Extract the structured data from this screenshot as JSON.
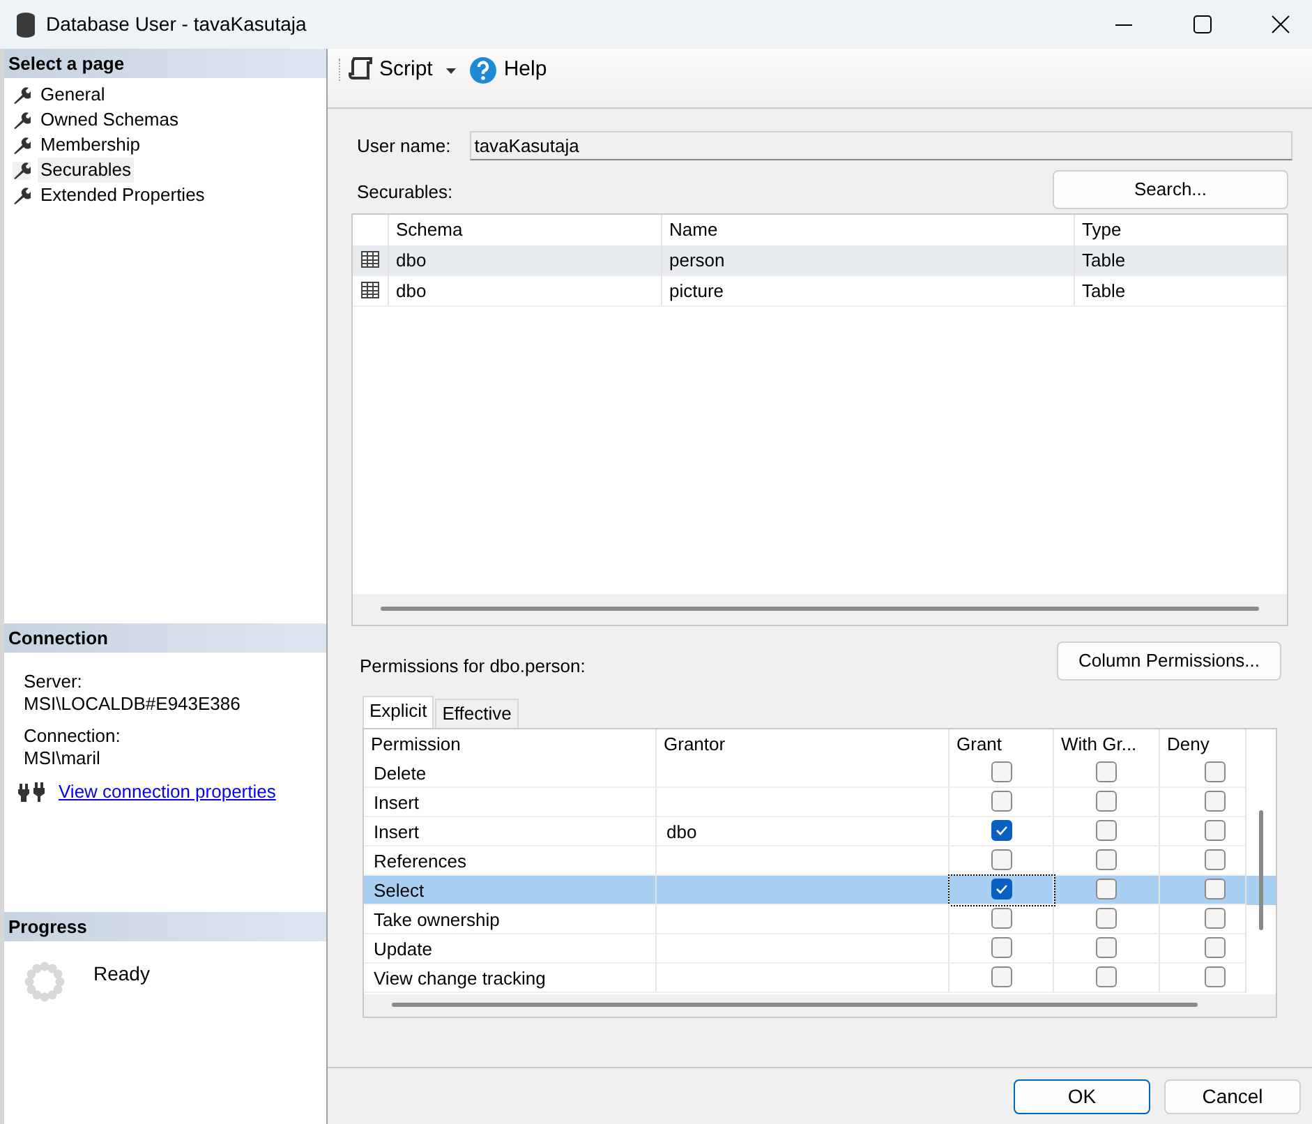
{
  "window": {
    "title": "Database User - tavaKasutaja"
  },
  "sidebar": {
    "title": "Select a page",
    "items": [
      {
        "label": "General",
        "selected": false
      },
      {
        "label": "Owned Schemas",
        "selected": false
      },
      {
        "label": "Membership",
        "selected": false
      },
      {
        "label": "Securables",
        "selected": true
      },
      {
        "label": "Extended Properties",
        "selected": false
      }
    ]
  },
  "connection": {
    "title": "Connection",
    "server_label": "Server:",
    "server": "MSI\\LOCALDB#E943E386",
    "connection_label": "Connection:",
    "connection": "MSI\\maril",
    "link": "View connection properties"
  },
  "progress": {
    "title": "Progress",
    "status": "Ready"
  },
  "toolbar": {
    "script": "Script",
    "help": "Help"
  },
  "user_name": {
    "label": "User name:",
    "value": "tavaKasutaja"
  },
  "securables": {
    "label": "Securables:",
    "search_button": "Search...",
    "columns": [
      "Schema",
      "Name",
      "Type"
    ],
    "rows": [
      {
        "cells": [
          "dbo",
          "person",
          "Table"
        ],
        "selected": true
      },
      {
        "cells": [
          "dbo",
          "picture",
          "Table"
        ],
        "selected": false
      }
    ]
  },
  "permissions": {
    "label": "Permissions for dbo.person:",
    "button": "Column Permissions...",
    "tabs": [
      {
        "label": "Explicit",
        "selected": true
      },
      {
        "label": "Effective",
        "selected": false
      }
    ],
    "columns": [
      "Permission",
      "Grantor",
      "Grant",
      "With Gr...",
      "Deny"
    ],
    "rows": [
      {
        "permission": "Delete",
        "grant": false,
        "with_grant": false,
        "deny": false,
        "selected": false
      },
      {
        "permission": "Insert",
        "grant": false,
        "with_grant": false,
        "deny": false,
        "selected": false
      },
      {
        "permission": "Insert",
        "grantor": "dbo",
        "grant": true,
        "with_grant": false,
        "deny": false,
        "selected": false
      },
      {
        "permission": "References",
        "grant": false,
        "with_grant": false,
        "deny": false,
        "selected": false
      },
      {
        "permission": "Select",
        "grant": true,
        "with_grant": false,
        "deny": false,
        "selected": true
      },
      {
        "permission": "Take ownership",
        "grant": false,
        "with_grant": false,
        "deny": false,
        "selected": false
      },
      {
        "permission": "Update",
        "grant": false,
        "with_grant": false,
        "deny": false,
        "selected": false
      },
      {
        "permission": "View change tracking",
        "grant": false,
        "with_grant": false,
        "deny": false,
        "selected": false
      }
    ]
  },
  "buttons": [
    {
      "label": "OK",
      "default": true
    },
    {
      "label": "Cancel",
      "default": false
    }
  ]
}
